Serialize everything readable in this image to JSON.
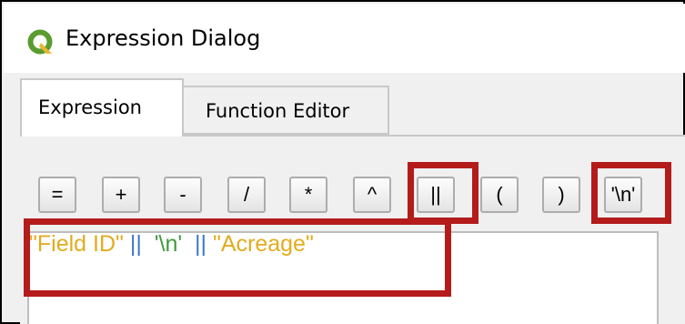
{
  "window": {
    "title": "Expression Dialog",
    "icon": "qgis-logo-icon"
  },
  "tabs": [
    {
      "label": "Expression",
      "active": true
    },
    {
      "label": "Function Editor",
      "active": false
    }
  ],
  "operators": [
    "=",
    "+",
    "-",
    "/",
    "*",
    "^",
    "||",
    "(",
    ")",
    "'\\n'"
  ],
  "editor": {
    "tokens": [
      {
        "text": "\"Field ID\"",
        "kind": "string"
      },
      {
        "text": " || ",
        "kind": "operator"
      },
      {
        "text": " '\\n' ",
        "kind": "literal"
      },
      {
        "text": " || ",
        "kind": "operator"
      },
      {
        "text": "\"Acreage\"",
        "kind": "string"
      }
    ]
  },
  "colors": {
    "highlight_box": "#b41b1b",
    "string_token": "#e2ac1f",
    "operator_token": "#3b78c6",
    "literal_token": "#3e9b3e"
  }
}
